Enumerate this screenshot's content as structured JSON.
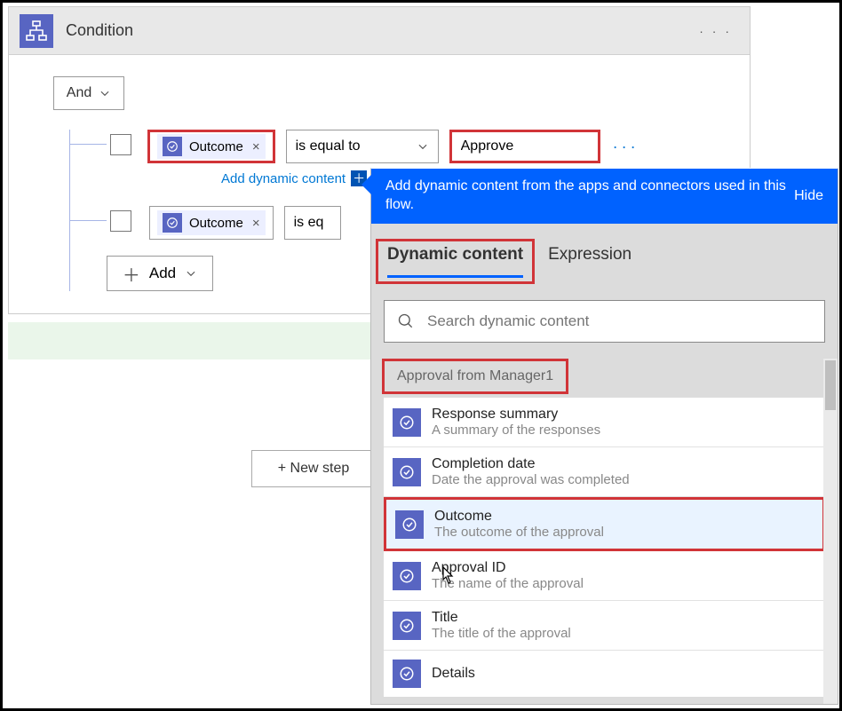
{
  "header": {
    "title": "Condition"
  },
  "logic": {
    "group_operator": "And",
    "rows": [
      {
        "token": "Outcome",
        "operator": "is equal to",
        "value": "Approve"
      },
      {
        "token": "Outcome",
        "operator": "is eq",
        "value": ""
      }
    ],
    "add_dynamic_label": "Add dynamic content",
    "add_label": "Add"
  },
  "new_step_label": "+ New step",
  "flyout": {
    "header_text": "Add dynamic content from the apps and connectors used in this flow.",
    "hide_label": "Hide",
    "tabs": {
      "dynamic": "Dynamic content",
      "expression": "Expression"
    },
    "search_placeholder": "Search dynamic content",
    "section": "Approval from Manager1",
    "items": [
      {
        "title": "Response summary",
        "desc": "A summary of the responses"
      },
      {
        "title": "Completion date",
        "desc": "Date the approval was completed"
      },
      {
        "title": "Outcome",
        "desc": "The outcome of the approval"
      },
      {
        "title": "Approval ID",
        "desc": "The name of the approval"
      },
      {
        "title": "Title",
        "desc": "The title of the approval"
      },
      {
        "title": "Details",
        "desc": ""
      }
    ]
  }
}
